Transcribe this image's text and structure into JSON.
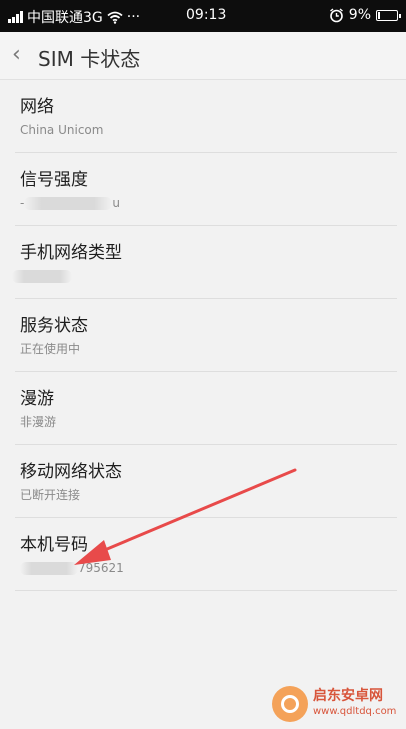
{
  "status_bar": {
    "carrier": "中国联通3G",
    "more": "···",
    "time": "09:13",
    "battery": "9%",
    "battery_level": 0.09
  },
  "header": {
    "title": "SIM 卡状态"
  },
  "items": [
    {
      "label": "网络",
      "value": "China Unicom"
    },
    {
      "label": "信号强度",
      "value_start": "-",
      "value_end": "u"
    },
    {
      "label": "手机网络类型"
    },
    {
      "label": "服务状态",
      "value": "正在使用中"
    },
    {
      "label": "漫游",
      "value": "非漫游"
    },
    {
      "label": "移动网络状态",
      "value": "已断开连接"
    },
    {
      "label": "本机号码",
      "value_end": "795621"
    }
  ],
  "watermark": {
    "name": "启东安卓网",
    "url": "www.qdltdq.com"
  },
  "colors": {
    "arrow": "#e84a4a",
    "status_bar": "#0d0d0d",
    "background": "#f2f2f2"
  }
}
